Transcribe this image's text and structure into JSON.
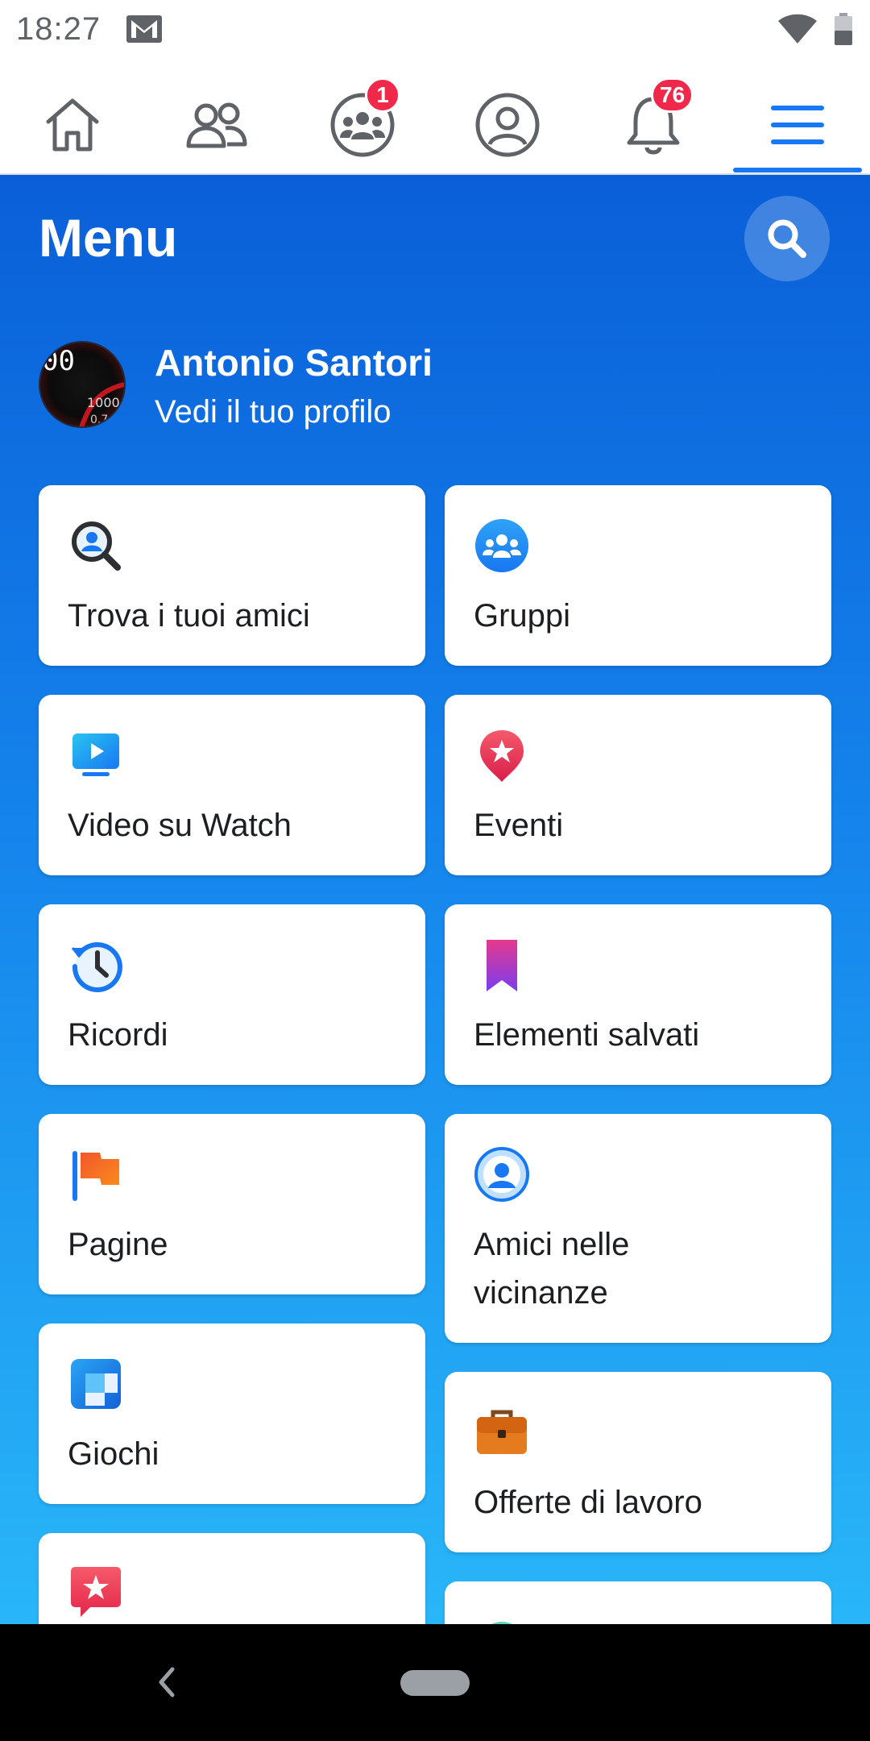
{
  "status_bar": {
    "time": "18:27"
  },
  "nav": {
    "items": [
      {
        "name": "home"
      },
      {
        "name": "friends"
      },
      {
        "name": "groups",
        "badge": "1"
      },
      {
        "name": "profile"
      },
      {
        "name": "notifications",
        "badge": "76"
      },
      {
        "name": "menu",
        "active": true
      }
    ]
  },
  "menu": {
    "title": "Menu"
  },
  "profile": {
    "name": "Antonio Santori",
    "subtitle": "Vedi il tuo profilo"
  },
  "cards": {
    "left": [
      {
        "label": "Trova i tuoi amici",
        "icon": "find-friends-icon"
      },
      {
        "label": "Video su Watch",
        "icon": "watch-video-icon"
      },
      {
        "label": "Ricordi",
        "icon": "memories-clock-icon"
      },
      {
        "label": "Pagine",
        "icon": "pages-flag-icon"
      },
      {
        "label": "Giochi",
        "icon": "games-icon"
      },
      {
        "label": "",
        "icon": "favorites-star-icon"
      }
    ],
    "right": [
      {
        "label": "Gruppi",
        "icon": "groups-icon"
      },
      {
        "label": "Eventi",
        "icon": "events-pin-icon"
      },
      {
        "label": "Elementi salvati",
        "icon": "saved-bookmark-icon"
      },
      {
        "label_line1": "Amici nelle",
        "label_line2": "vicinanze",
        "icon": "nearby-friends-icon"
      },
      {
        "label": "Offerte di lavoro",
        "icon": "jobs-briefcase-icon"
      },
      {
        "label": "",
        "icon": "partial-icon"
      }
    ]
  },
  "colors": {
    "accent": "#1877f2",
    "badge": "#f0284a",
    "gradient_top": "#0a5fd8",
    "gradient_bottom": "#29b6f8"
  }
}
